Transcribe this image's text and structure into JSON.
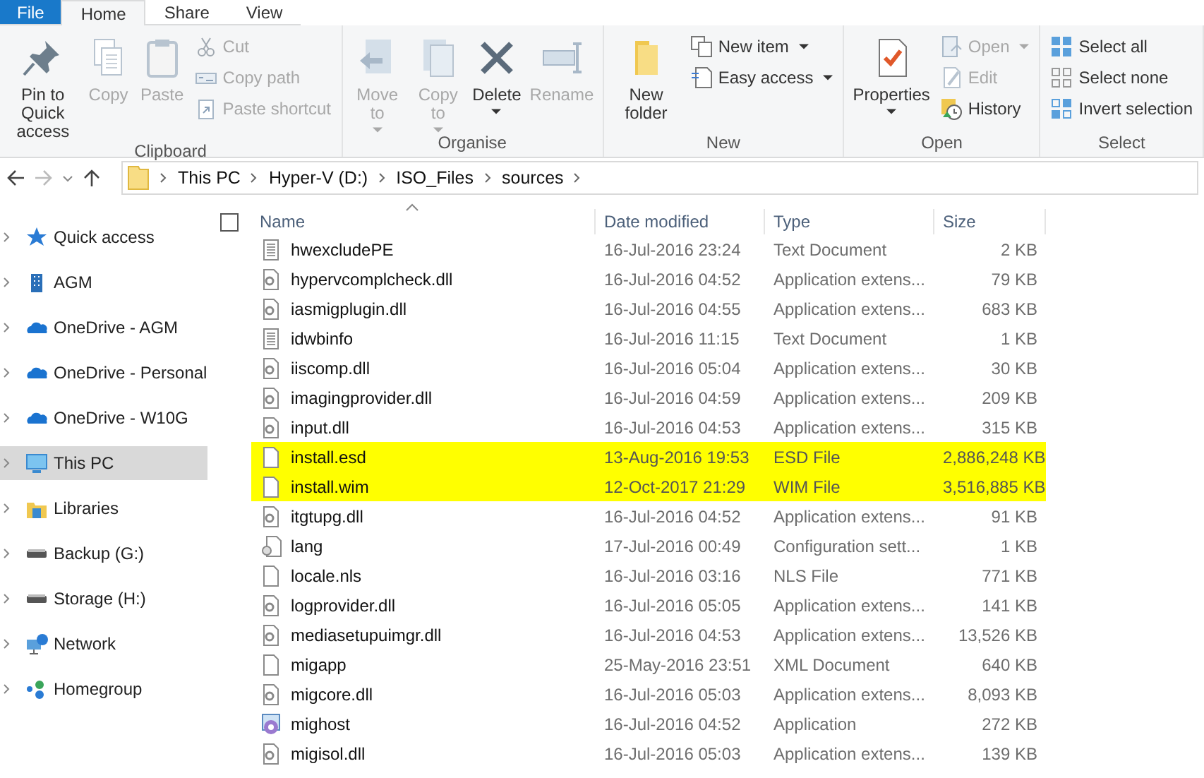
{
  "tabs": [
    {
      "label": "File",
      "kind": "file",
      "selected": false
    },
    {
      "label": "Home",
      "kind": "tab",
      "selected": true
    },
    {
      "label": "Share",
      "kind": "tab",
      "selected": false
    },
    {
      "label": "View",
      "kind": "tab",
      "selected": false
    }
  ],
  "ribbon": {
    "groups": [
      {
        "label": "Clipboard",
        "columns": [
          {
            "kind": "large",
            "label": "Pin to Quick access",
            "disabled": false,
            "dropdown": false
          },
          {
            "kind": "large",
            "label": "Copy",
            "disabled": true,
            "dropdown": false
          },
          {
            "kind": "large",
            "label": "Paste",
            "disabled": true,
            "dropdown": false
          },
          {
            "kind": "stack",
            "items": [
              {
                "label": "Cut",
                "disabled": true,
                "dropdown": false
              },
              {
                "label": "Copy path",
                "disabled": true,
                "dropdown": false
              },
              {
                "label": "Paste shortcut",
                "disabled": true,
                "dropdown": false
              }
            ]
          }
        ]
      },
      {
        "label": "Organise",
        "columns": [
          {
            "kind": "large",
            "label": "Move to",
            "disabled": true,
            "dropdown": true
          },
          {
            "kind": "large",
            "label": "Copy to",
            "disabled": true,
            "dropdown": true
          },
          {
            "kind": "large",
            "label": "Delete",
            "disabled": false,
            "dropdown": true
          },
          {
            "kind": "large",
            "label": "Rename",
            "disabled": true,
            "dropdown": false
          }
        ]
      },
      {
        "label": "New",
        "columns": [
          {
            "kind": "large",
            "label": "New folder",
            "disabled": false,
            "dropdown": false
          },
          {
            "kind": "stack",
            "items": [
              {
                "label": "New item",
                "disabled": false,
                "dropdown": true
              },
              {
                "label": "Easy access",
                "disabled": false,
                "dropdown": true
              }
            ]
          }
        ]
      },
      {
        "label": "Open",
        "columns": [
          {
            "kind": "large",
            "label": "Properties",
            "disabled": false,
            "dropdown": true
          },
          {
            "kind": "stack",
            "items": [
              {
                "label": "Open",
                "disabled": true,
                "dropdown": true
              },
              {
                "label": "Edit",
                "disabled": true,
                "dropdown": false
              },
              {
                "label": "History",
                "disabled": false,
                "dropdown": false
              }
            ]
          }
        ]
      },
      {
        "label": "Select",
        "columns": [
          {
            "kind": "stack",
            "items": [
              {
                "label": "Select all",
                "disabled": false,
                "dropdown": false
              },
              {
                "label": "Select none",
                "disabled": false,
                "dropdown": false
              },
              {
                "label": "Invert selection",
                "disabled": false,
                "dropdown": false
              }
            ]
          }
        ]
      }
    ]
  },
  "address": {
    "crumbs": [
      "This PC",
      "Hyper-V (D:)",
      "ISO_Files",
      "sources"
    ]
  },
  "sidebar": {
    "items": [
      {
        "label": "Quick access",
        "selected": false
      },
      {
        "label": "AGM",
        "selected": false
      },
      {
        "label": "OneDrive - AGM",
        "selected": false
      },
      {
        "label": "OneDrive - Personal",
        "selected": false
      },
      {
        "label": "OneDrive - W10G",
        "selected": false
      },
      {
        "label": "This PC",
        "selected": true
      },
      {
        "label": "Libraries",
        "selected": false
      },
      {
        "label": "Backup (G:)",
        "selected": false
      },
      {
        "label": "Storage (H:)",
        "selected": false
      },
      {
        "label": "Network",
        "selected": false
      },
      {
        "label": "Homegroup",
        "selected": false
      }
    ]
  },
  "table": {
    "select_all": {
      "checked": false
    },
    "columns": [
      "Name",
      "Date modified",
      "Type",
      "Size"
    ],
    "rows": [
      {
        "name": "hwexcludePE",
        "date": "16-Jul-2016 23:24",
        "type": "Text Document",
        "size": "2 KB",
        "kind": "text",
        "highlighted": false
      },
      {
        "name": "hypervcomplcheck.dll",
        "date": "16-Jul-2016 04:52",
        "type": "Application extens...",
        "size": "79 KB",
        "kind": "dll",
        "highlighted": false
      },
      {
        "name": "iasmigplugin.dll",
        "date": "16-Jul-2016 04:55",
        "type": "Application extens...",
        "size": "683 KB",
        "kind": "dll",
        "highlighted": false
      },
      {
        "name": "idwbinfo",
        "date": "16-Jul-2016 11:15",
        "type": "Text Document",
        "size": "1 KB",
        "kind": "text",
        "highlighted": false
      },
      {
        "name": "iiscomp.dll",
        "date": "16-Jul-2016 05:04",
        "type": "Application extens...",
        "size": "30 KB",
        "kind": "dll",
        "highlighted": false
      },
      {
        "name": "imagingprovider.dll",
        "date": "16-Jul-2016 04:59",
        "type": "Application extens...",
        "size": "209 KB",
        "kind": "dll",
        "highlighted": false
      },
      {
        "name": "input.dll",
        "date": "16-Jul-2016 04:53",
        "type": "Application extens...",
        "size": "315 KB",
        "kind": "dll",
        "highlighted": false
      },
      {
        "name": "install.esd",
        "date": "13-Aug-2016 19:53",
        "type": "ESD File",
        "size": "2,886,248 KB",
        "kind": "blank",
        "highlighted": true
      },
      {
        "name": "install.wim",
        "date": "12-Oct-2017 21:29",
        "type": "WIM File",
        "size": "3,516,885 KB",
        "kind": "blank",
        "highlighted": true
      },
      {
        "name": "itgtupg.dll",
        "date": "16-Jul-2016 04:52",
        "type": "Application extens...",
        "size": "91 KB",
        "kind": "dll",
        "highlighted": false
      },
      {
        "name": "lang",
        "date": "17-Jul-2016 00:49",
        "type": "Configuration sett...",
        "size": "1 KB",
        "kind": "config",
        "highlighted": false
      },
      {
        "name": "locale.nls",
        "date": "16-Jul-2016 03:16",
        "type": "NLS File",
        "size": "771 KB",
        "kind": "blank",
        "highlighted": false
      },
      {
        "name": "logprovider.dll",
        "date": "16-Jul-2016 05:05",
        "type": "Application extens...",
        "size": "141 KB",
        "kind": "dll",
        "highlighted": false
      },
      {
        "name": "mediasetupuimgr.dll",
        "date": "16-Jul-2016 04:53",
        "type": "Application extens...",
        "size": "13,526 KB",
        "kind": "dll",
        "highlighted": false
      },
      {
        "name": "migapp",
        "date": "25-May-2016 23:51",
        "type": "XML Document",
        "size": "640 KB",
        "kind": "blank",
        "highlighted": false
      },
      {
        "name": "migcore.dll",
        "date": "16-Jul-2016 05:03",
        "type": "Application extens...",
        "size": "8,093 KB",
        "kind": "dll",
        "highlighted": false
      },
      {
        "name": "mighost",
        "date": "16-Jul-2016 04:52",
        "type": "Application",
        "size": "272 KB",
        "kind": "app",
        "highlighted": false
      },
      {
        "name": "migisol.dll",
        "date": "16-Jul-2016 05:03",
        "type": "Application extens...",
        "size": "139 KB",
        "kind": "dll",
        "highlighted": false
      }
    ]
  }
}
